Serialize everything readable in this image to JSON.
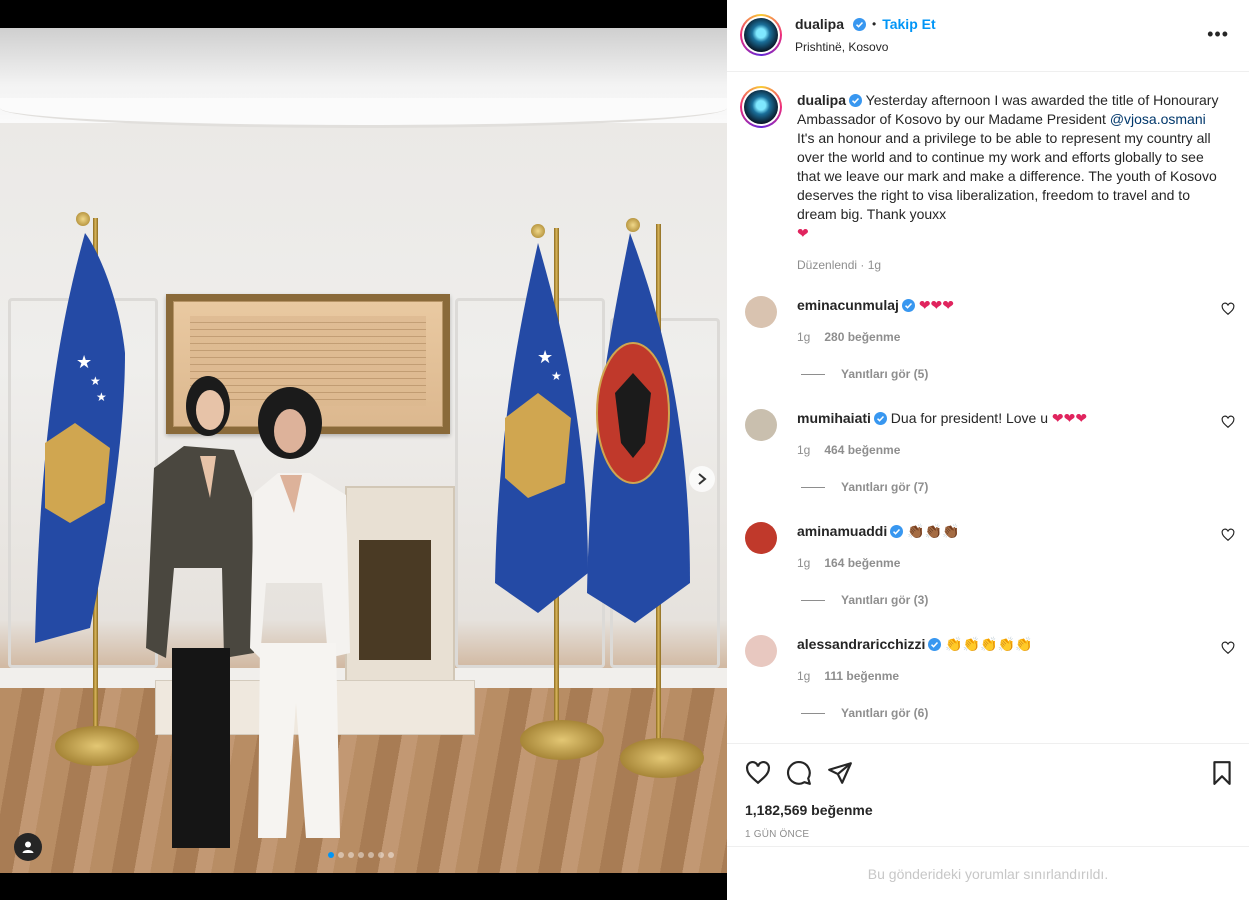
{
  "post": {
    "author": "dualipa",
    "follow_label": "Takip Et",
    "separator": "•",
    "location": "Prishtinë, Kosovo",
    "more_label": "•••"
  },
  "caption": {
    "author": "dualipa",
    "text_before": "Yesterday afternoon I was awarded the title of Honourary Ambassador of Kosovo by our Madame President ",
    "mention": "@vjosa.osmani",
    "text_after": " It's an honour and a privilege to be able to represent my country all over the world and to continue my work and efforts globally to see that we leave our mark and make a difference. The youth of Kosovo deserves the right to visa liberalization, freedom to travel and to dream big. Thank youxx",
    "emoji": "❤",
    "edited": "Düzenlendi",
    "time": "1g"
  },
  "comments": [
    {
      "user": "eminacunmulaj",
      "text": "",
      "emoji": "❤❤❤",
      "time": "1g",
      "likes": "280 beğenme",
      "replies": "Yanıtları gör (5)",
      "avatar_color": "#d9c3b0"
    },
    {
      "user": "mumihaiati",
      "text": "Dua for president! Love u ",
      "emoji": "❤❤❤",
      "time": "1g",
      "likes": "464 beğenme",
      "replies": "Yanıtları gör (7)",
      "avatar_color": "#c9bfae"
    },
    {
      "user": "aminamuaddi",
      "text": "",
      "emoji": "👏🏾👏🏾👏🏾",
      "time": "1g",
      "likes": "164 beğenme",
      "replies": "Yanıtları gör (3)",
      "avatar_color": "#c0392b"
    },
    {
      "user": "alessandraricchizzi",
      "text": "",
      "emoji": "👏👏👏👏👏",
      "time": "1g",
      "likes": "111 beğenme",
      "replies": "Yanıtları gör (6)",
      "avatar_color": "#e8c8c0"
    }
  ],
  "stats": {
    "likes": "1,182,569 beğenme",
    "time_ago": "1 GÜN ÖNCE",
    "comments_limited": "Bu gönderideki yorumlar sınırlandırıldı."
  },
  "carousel": {
    "total": 7,
    "active_index": 0
  },
  "colors": {
    "accent": "#0095f6",
    "verified": "#3897f0",
    "flag_blue": "#244aa5",
    "flag_gold": "#d0a650"
  }
}
